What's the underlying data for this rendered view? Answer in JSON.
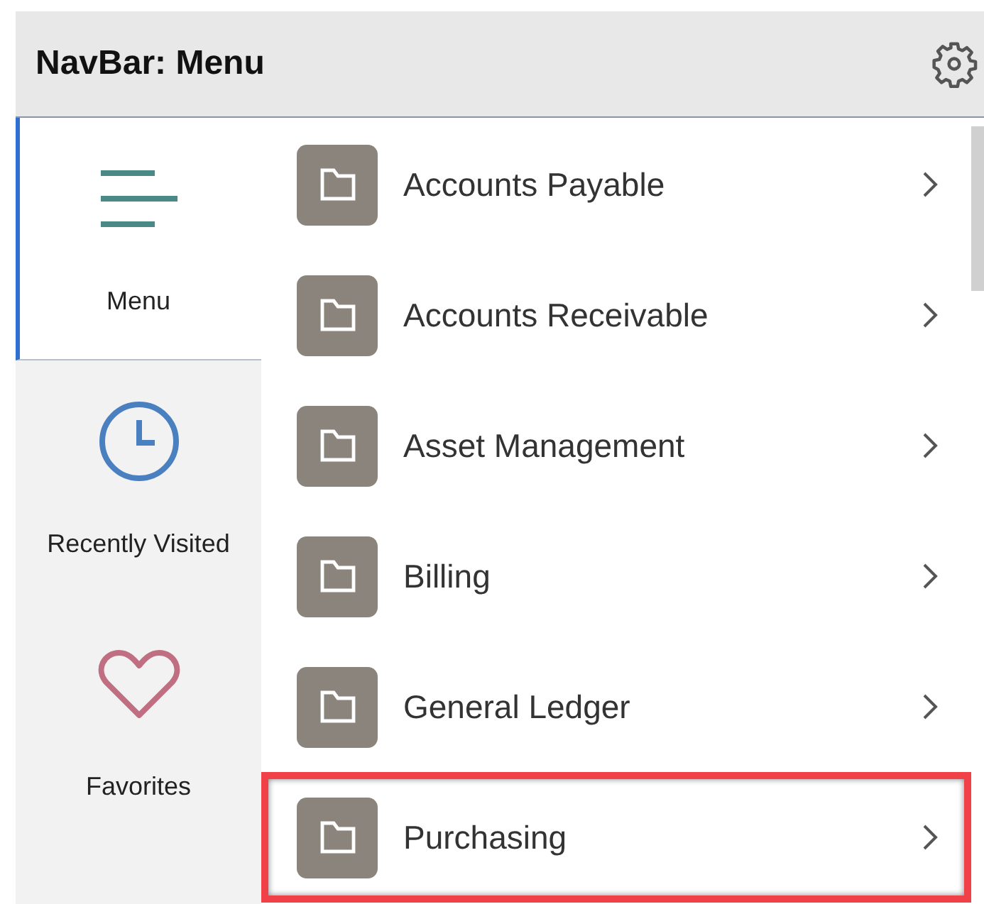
{
  "header": {
    "title": "NavBar: Menu"
  },
  "sidebar": {
    "items": [
      {
        "label": "Menu",
        "kind": "menu",
        "selected": true
      },
      {
        "label": "Recently Visited",
        "kind": "recent",
        "selected": false
      },
      {
        "label": "Favorites",
        "kind": "favorites",
        "selected": false
      }
    ]
  },
  "menu": {
    "items": [
      {
        "label": "Accounts Payable",
        "highlighted": false
      },
      {
        "label": "Accounts Receivable",
        "highlighted": false
      },
      {
        "label": "Asset Management",
        "highlighted": false
      },
      {
        "label": "Billing",
        "highlighted": false
      },
      {
        "label": "General Ledger",
        "highlighted": false
      },
      {
        "label": "Purchasing",
        "highlighted": true
      }
    ]
  }
}
